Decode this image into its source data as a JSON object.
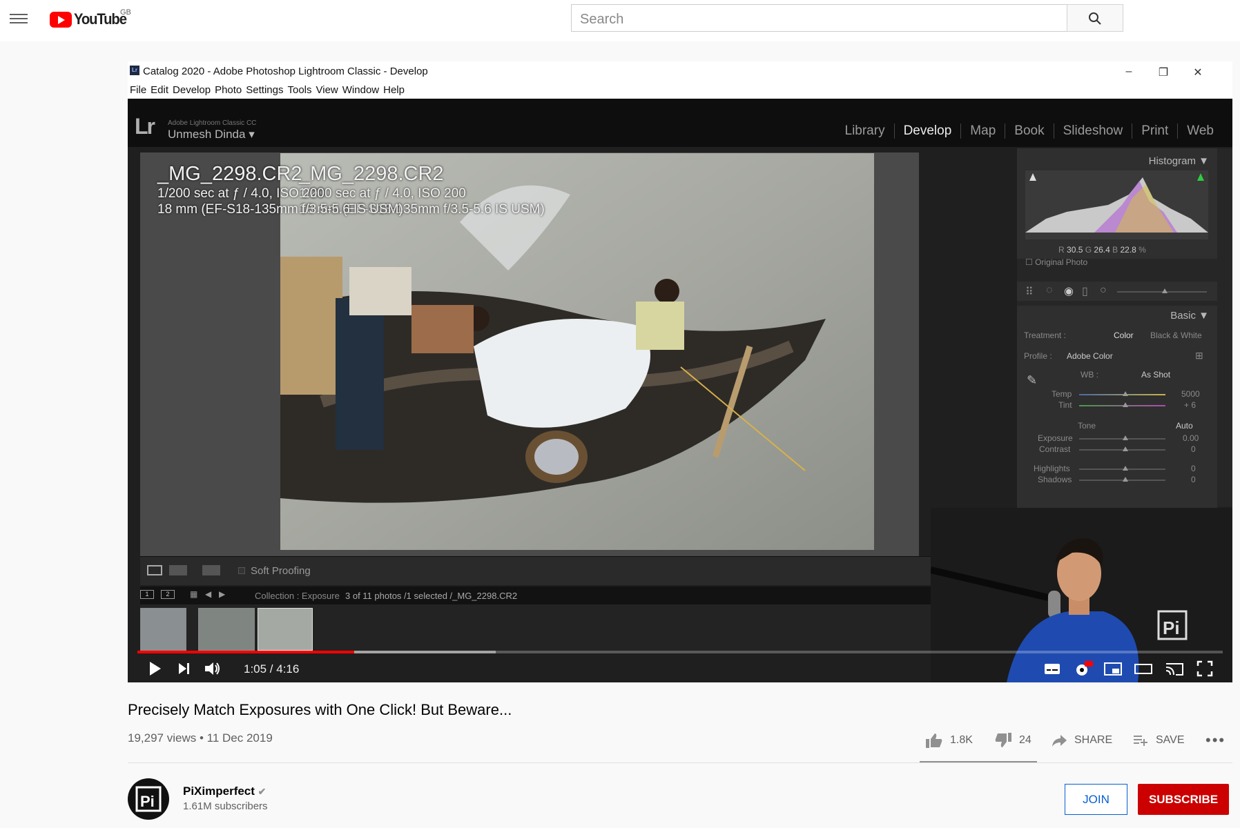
{
  "masthead": {
    "logo_text": "YouTube",
    "country": "GB",
    "search_placeholder": "Search"
  },
  "lightroom": {
    "window_title": "Catalog 2020 - Adobe Photoshop Lightroom Classic - Develop",
    "menu": [
      "File",
      "Edit",
      "Develop",
      "Photo",
      "Settings",
      "Tools",
      "View",
      "Window",
      "Help"
    ],
    "brand": "Adobe Lightroom Classic CC",
    "user": "Unmesh Dinda",
    "modules": [
      "Library",
      "Develop",
      "Map",
      "Book",
      "Slideshow",
      "Print",
      "Web"
    ],
    "active_module": "Develop",
    "photo_info": {
      "filename": "_MG_2298.CR2",
      "exposure": "1/200 sec at ƒ / 4.0, ISO 200",
      "lens": "18 mm (EF-S18-135mm f/3.5-5.6 IS USM)"
    },
    "soft_proofing": "Soft Proofing",
    "collection": "Collection : Exposure",
    "selection_info": "3 of 11 photos /1 selected /_MG_2298.CR2",
    "histogram": {
      "title": "Histogram",
      "r_label": "R",
      "r": "30.5",
      "g_label": "G",
      "g": "26.4",
      "b_label": "B",
      "b": "22.8",
      "unit": "%",
      "original_photo": "Original Photo"
    },
    "basic": {
      "title": "Basic",
      "treatment_label": "Treatment :",
      "color": "Color",
      "bw": "Black & White",
      "profile_label": "Profile :",
      "profile": "Adobe Color",
      "wb_label": "WB :",
      "wb": "As Shot",
      "temp_label": "Temp",
      "temp": "5000",
      "tint_label": "Tint",
      "tint": "+ 6",
      "tone_label": "Tone",
      "auto": "Auto",
      "exposure_label": "Exposure",
      "exposure": "0.00",
      "contrast_label": "Contrast",
      "contrast": "0",
      "highlights_label": "Highlights",
      "highlights": "0",
      "shadows_label": "Shadows",
      "shadows": "0"
    }
  },
  "player": {
    "time": "1:05 / 4:16",
    "progress": 0.2,
    "buffered": 0.33
  },
  "video": {
    "title": "Precisely Match Exposures with One Click! But Beware...",
    "views": "19,297 views • 11 Dec 2019",
    "likes": "1.8K",
    "dislikes": "24",
    "share": "SHARE",
    "save": "SAVE"
  },
  "channel": {
    "name": "PiXimperfect",
    "subscribers": "1.61M subscribers",
    "join": "JOIN",
    "subscribe": "SUBSCRIBE"
  },
  "colors": {
    "brand_red": "#ff0000",
    "subscribe_red": "#cc0000",
    "join_blue": "#065fd4"
  }
}
